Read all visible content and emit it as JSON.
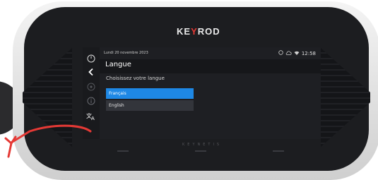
{
  "brand": {
    "logo_pre": "KE",
    "logo_accent": "Y",
    "logo_post": "ROD",
    "footer": "KEYNETIS"
  },
  "status": {
    "date": "Lundi 20 novembre 2023",
    "time": "12:58"
  },
  "header": {
    "title": "Langue"
  },
  "main": {
    "prompt": "Choisissez votre langue",
    "languages": [
      {
        "label": "Français",
        "selected": true
      },
      {
        "label": "English",
        "selected": false
      }
    ]
  },
  "sidebar_icons": [
    "power-icon",
    "back-icon",
    "settings-icon",
    "info-icon",
    "translate-icon"
  ],
  "colors": {
    "accent": "#1e88e5",
    "annotation_arrow": "#e53935",
    "screen_bg": "#1e1f23"
  }
}
